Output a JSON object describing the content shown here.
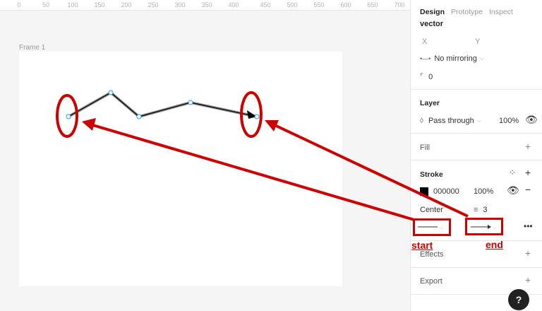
{
  "ruler": {
    "ticks": [
      "0",
      "50",
      "100",
      "150",
      "200",
      "250",
      "300",
      "350",
      "400",
      "450",
      "500",
      "550",
      "600",
      "650",
      "700"
    ]
  },
  "canvas": {
    "frame_label": "Frame 1"
  },
  "panel": {
    "tabs": [
      "Design",
      "Prototype",
      "Inspect"
    ],
    "vector_label": "vector",
    "x_label": "X",
    "y_label": "Y",
    "mirroring": "No mirroring",
    "corner_radius": "0",
    "layer": {
      "title": "Layer",
      "blend": "Pass through",
      "opacity": "100%"
    },
    "fill": {
      "title": "Fill"
    },
    "stroke": {
      "title": "Stroke",
      "color": "000000",
      "opacity": "100%",
      "align": "Center",
      "weight": "3"
    },
    "effects": {
      "title": "Effects"
    },
    "export": {
      "title": "Export"
    }
  },
  "annotations": {
    "start_label": "start",
    "end_label": "end"
  },
  "colors": {
    "annotation": "#d10000",
    "accent": "#18a0fb"
  },
  "help": {
    "label": "?"
  }
}
